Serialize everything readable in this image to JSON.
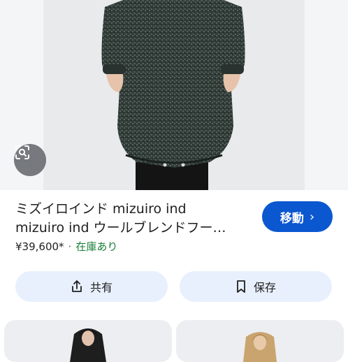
{
  "product": {
    "title_line1": "ミズイロインド mizuiro ind",
    "title_line2": "mizuiro ind ウールブレンドフー…",
    "price": "¥39,600*",
    "separator": "·",
    "availability": "在庫あり"
  },
  "actions": {
    "go_label": "移動",
    "go_chevron": "›",
    "share_label": "共有",
    "save_label": "保存"
  },
  "icons": {
    "lens": "lens-search-icon",
    "share": "share-icon",
    "save": "bookmark-icon"
  },
  "colors": {
    "primary_button": "#0b57d0",
    "pill_background": "#e8f0fe",
    "availability": "#188038"
  }
}
